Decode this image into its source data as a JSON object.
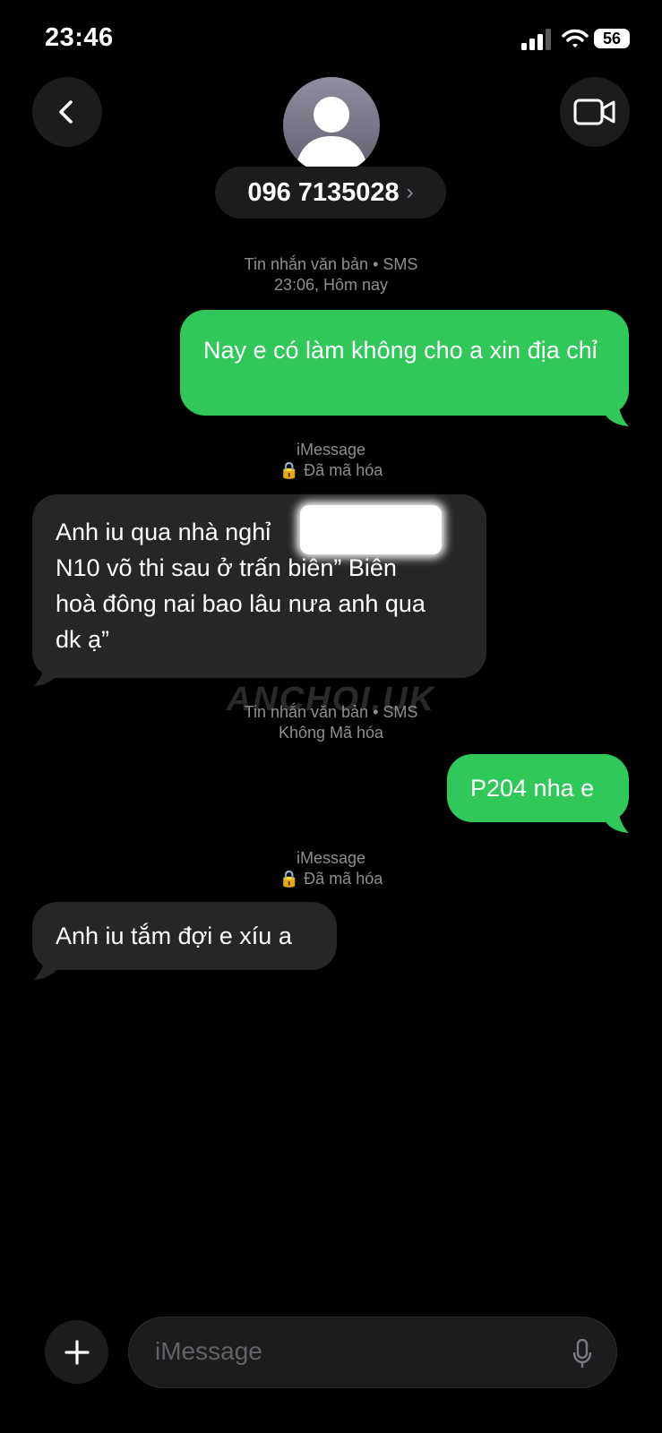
{
  "status_bar": {
    "time": "23:46",
    "battery": "56",
    "icons": [
      "signal-icon",
      "wifi-icon"
    ]
  },
  "header": {
    "contact": "096 7135028",
    "chevron": "›",
    "icons": [
      "chevron-left-icon",
      "person-icon",
      "video-camera-icon"
    ]
  },
  "thread": [
    {
      "type": "meta",
      "line1": "Tin nhắn văn bản • SMS",
      "line2": "23:06, Hôm nay"
    },
    {
      "type": "sent",
      "text": "Nay e có làm không cho a xin địa chỉ"
    },
    {
      "type": "meta",
      "line1": "iMessage",
      "line2": "🔒 Đã mã hóa"
    },
    {
      "type": "received",
      "lines": [
        "Anh iu qua nhà nghỉ",
        "N10 võ thi sau ở trấn biên” Biên",
        "hoà đông nai bao lâu nưa anh qua",
        "dk ạ”"
      ]
    },
    {
      "type": "meta",
      "line1": "Tin nhắn văn bản • SMS",
      "line2": "Không Mã hóa"
    },
    {
      "type": "sent",
      "text": "P204 nha e"
    },
    {
      "type": "meta",
      "line1": "iMessage",
      "line2": "🔒 Đã mã hóa"
    },
    {
      "type": "received",
      "text": "Anh iu tắm đợi e xíu a"
    }
  ],
  "watermark": "ANCHOI.UK",
  "composer": {
    "placeholder": "iMessage",
    "icons": [
      "plus-icon",
      "microphone-icon"
    ]
  },
  "colors": {
    "sent_bubble": "#31c85a",
    "received_bubble": "#262628",
    "background": "#000000",
    "meta_text": "#8e8e93"
  }
}
